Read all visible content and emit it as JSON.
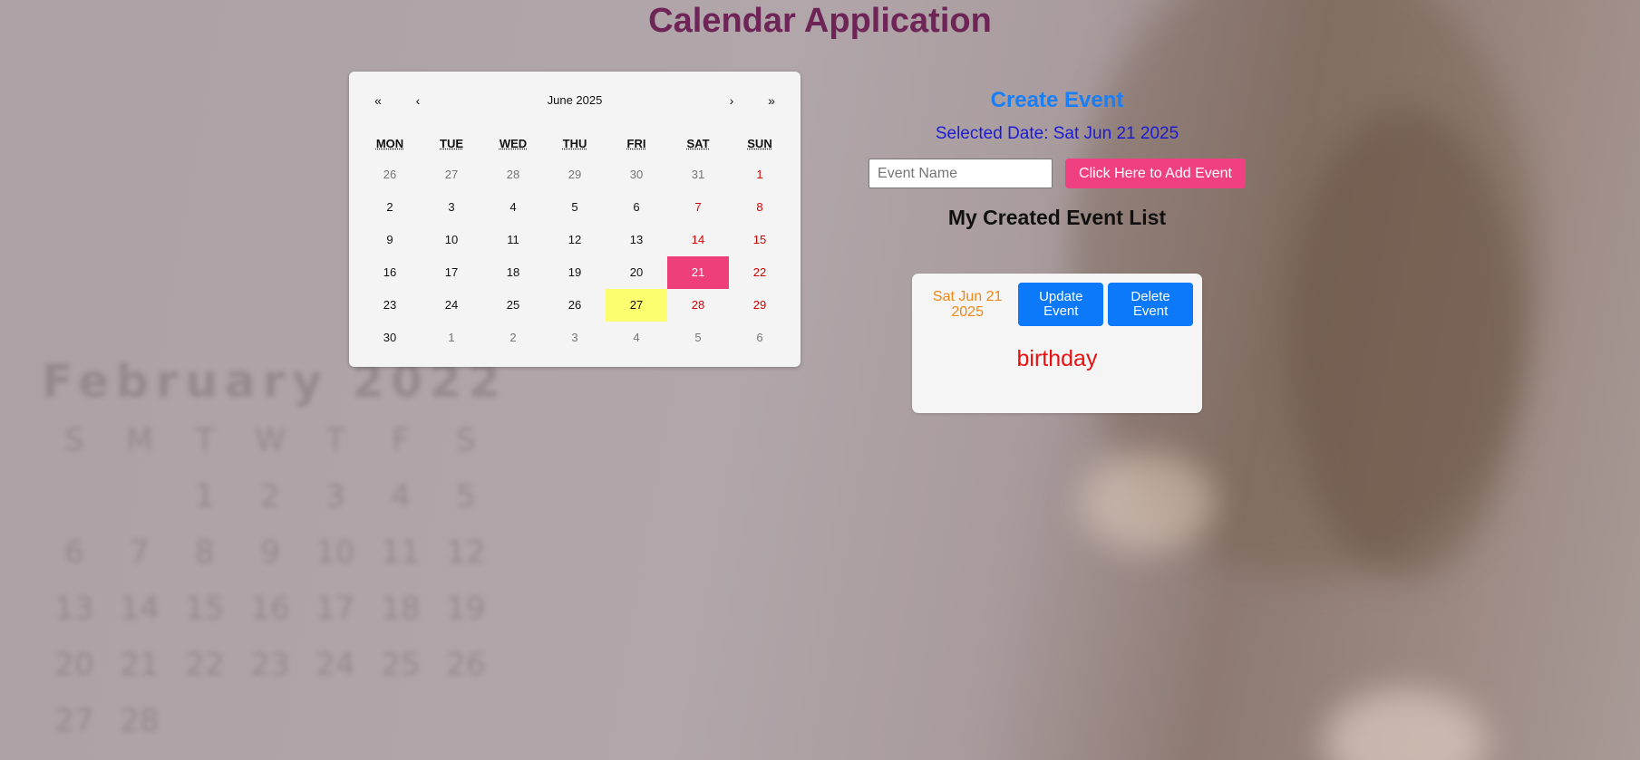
{
  "app": {
    "title": "Calendar Application"
  },
  "calendar": {
    "nav": {
      "prev_year": "«",
      "prev_month": "‹",
      "next_month": "›",
      "next_year": "»"
    },
    "month_label": "June 2025",
    "weekdays": [
      "MON",
      "TUE",
      "WED",
      "THU",
      "FRI",
      "SAT",
      "SUN"
    ],
    "weeks": [
      [
        "26",
        "27",
        "28",
        "29",
        "30",
        "31",
        "1"
      ],
      [
        "2",
        "3",
        "4",
        "5",
        "6",
        "7",
        "8"
      ],
      [
        "9",
        "10",
        "11",
        "12",
        "13",
        "14",
        "15"
      ],
      [
        "16",
        "17",
        "18",
        "19",
        "20",
        "21",
        "22"
      ],
      [
        "23",
        "24",
        "25",
        "26",
        "27",
        "28",
        "29"
      ],
      [
        "30",
        "1",
        "2",
        "3",
        "4",
        "5",
        "6"
      ]
    ],
    "selected_day": "21",
    "today_day": "27",
    "colors": {
      "selected": "#ef3f7a",
      "today": "#fdfd70",
      "weekend": "#d10000",
      "other_month": "#757575"
    }
  },
  "create_event": {
    "title": "Create Event",
    "selected_date_text": "Selected Date: Sat Jun 21 2025",
    "input_placeholder": "Event Name",
    "input_value": "",
    "add_button_label": "Click Here to Add Event"
  },
  "event_list": {
    "title": "My Created Event List",
    "events": [
      {
        "date": "Sat Jun 21 2025",
        "update_label": "Update Event",
        "delete_label": "Delete Event",
        "name": "birthday"
      }
    ]
  },
  "background": {
    "calendar_title": "February 2022",
    "weekdays": [
      "S",
      "M",
      "T",
      "W",
      "T",
      "F",
      "S"
    ],
    "days": [
      "",
      "",
      "1",
      "2",
      "3",
      "4",
      "5",
      "6",
      "7",
      "8",
      "9",
      "10",
      "11",
      "12",
      "13",
      "14",
      "15",
      "16",
      "17",
      "18",
      "19",
      "20",
      "21",
      "22",
      "23",
      "24",
      "25",
      "26",
      "27",
      "28"
    ]
  }
}
